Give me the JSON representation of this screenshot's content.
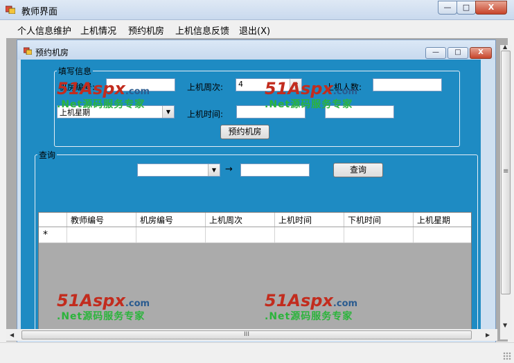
{
  "window": {
    "title": "教师界面",
    "min": "—",
    "max": "□",
    "close": "X"
  },
  "menu": [
    "个人信息维护",
    "上机情况",
    "预约机房",
    "上机信息反馈",
    "退出(X)"
  ],
  "child": {
    "title": "预约机房",
    "min": "—",
    "max": "□",
    "close": "X"
  },
  "form": {
    "group_label": "填写信息",
    "room_no_label": "机房编号:",
    "week_label": "上机周次:",
    "week_value": "4",
    "people_label": "上机人数:",
    "weekday_label": "上机星期",
    "time_label": "上机时间:",
    "submit": "预约机房"
  },
  "query": {
    "group_label": "查询",
    "combo_value": "",
    "arrow": "→",
    "button": "查询"
  },
  "grid": {
    "columns": [
      "教师编号",
      "机房编号",
      "上机周次",
      "上机时间",
      "下机时间",
      "上机星期"
    ],
    "new_row_marker": "*"
  },
  "scroll": {
    "up": "▲",
    "down": "▼",
    "left": "◀",
    "right": "▶",
    "grip_v": "≡",
    "grip_h": "III"
  },
  "watermark": {
    "brand": "51Aspx",
    "domain": ".com",
    "slogan": ".Net源码服务专家"
  }
}
